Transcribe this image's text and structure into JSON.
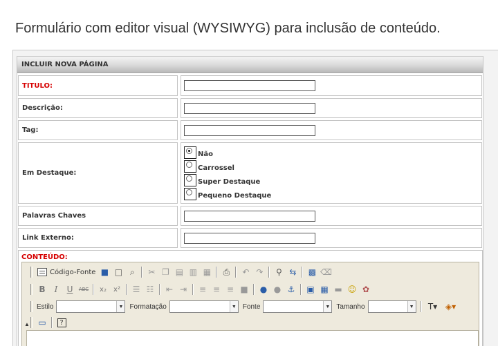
{
  "caption": "Formulário com editor visual (WYSIWYG) para inclusão de conteúdo.",
  "form": {
    "header": "INCLUIR NOVA PÁGINA",
    "fields": {
      "titulo": "TITULO:",
      "descricao": "Descrição:",
      "tag": "Tag:",
      "destaque": "Em Destaque:",
      "palavras": "Palavras Chaves",
      "link": "Link Externo:"
    },
    "destaque_options": [
      "Não",
      "Carrossel",
      "Super Destaque",
      "Pequeno Destaque"
    ],
    "destaque_selected": "Não",
    "content_label": "CONTEÚDO:"
  },
  "editor": {
    "source_label": "Código-Fonte",
    "style_label": "Estilo",
    "format_label": "Formatação",
    "font_label": "Fonte",
    "size_label": "Tamanho",
    "strike_label": "ABC",
    "subscript_label": "x₂",
    "superscript_label": "x²",
    "help_label": "?"
  },
  "colors": {
    "required_label": "#d60000",
    "editor_bg": "#eeeadd"
  }
}
